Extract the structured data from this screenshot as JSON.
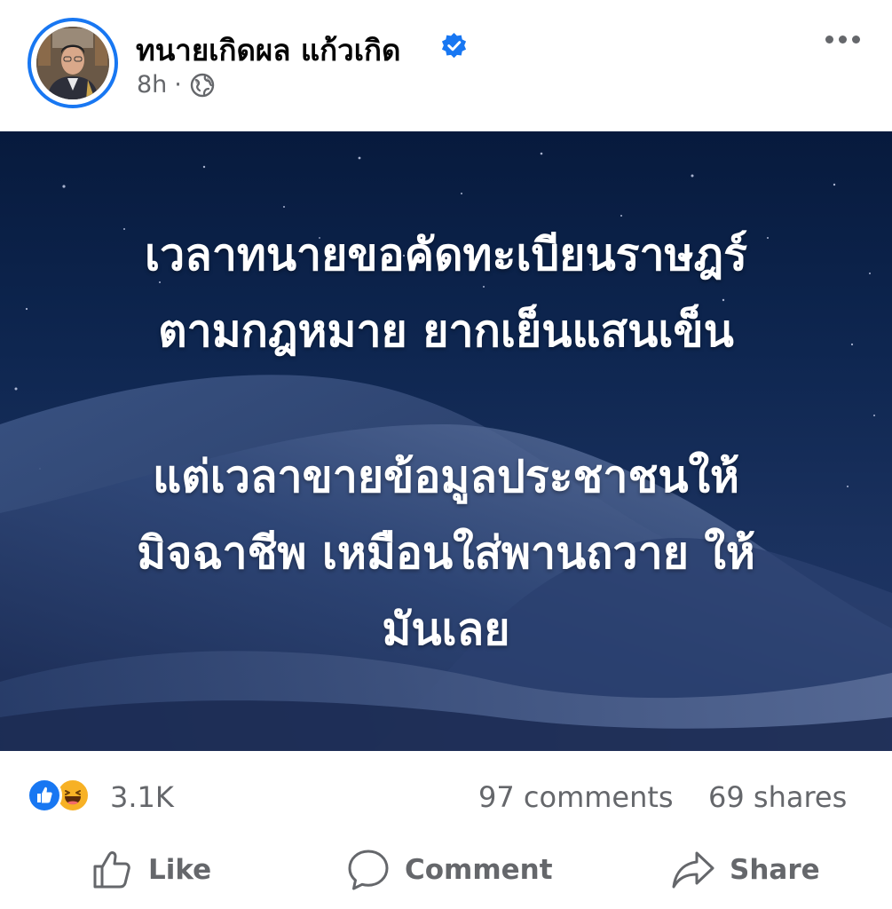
{
  "post": {
    "author": "ทนายเกิดผล แก้วเกิด",
    "time": "8h",
    "separator": "·",
    "audience_icon": "globe-icon",
    "verified_icon": "verified-badge-icon",
    "more_icon": "more-options-icon",
    "image_text": {
      "line1": "เวลาทนายขอคัดทะเบียนราษฎร์",
      "line2": "ตามกฎหมาย ยากเย็นแสนเข็น",
      "line3": "แต่เวลาขายข้อมูลประชาชนให้",
      "line4": "มิจฉาชีพ เหมือนใส่พานถวาย ให้",
      "line5": "มันเลย"
    }
  },
  "stats": {
    "reaction_icons": [
      "like-reaction-icon",
      "haha-reaction-icon"
    ],
    "reactions": "3.1K",
    "comments": "97 comments",
    "shares": "69 shares"
  },
  "actions": {
    "like": "Like",
    "comment": "Comment",
    "share": "Share"
  },
  "colors": {
    "accent": "#1877f2",
    "muted_text": "#65676b",
    "haha": "#f7b125",
    "image_bg": "#0e2650"
  }
}
